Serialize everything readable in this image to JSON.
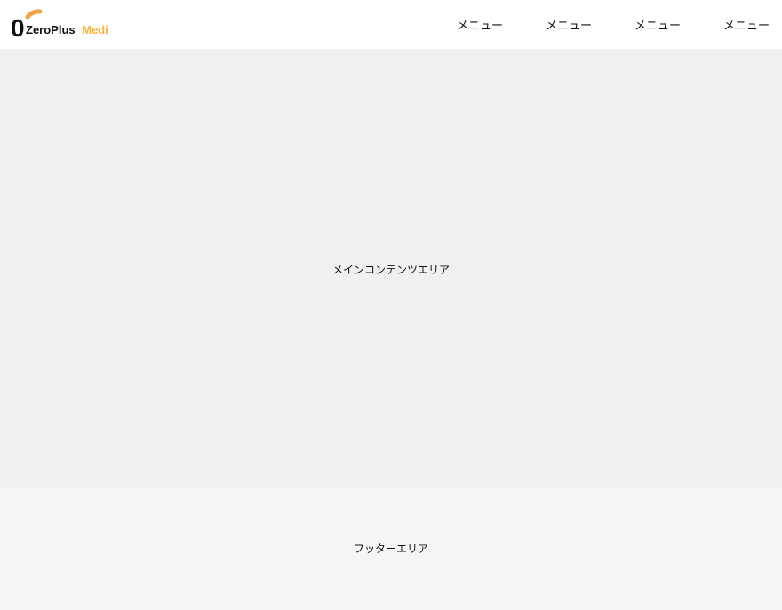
{
  "header": {
    "logo": {
      "glyph": "0",
      "brand_primary": "ZeroPlus",
      "brand_secondary": "Media",
      "primary_color": "#111111",
      "accent_color": "#f5b23d",
      "dot_color": "#f2a34a"
    },
    "nav": {
      "items": [
        {
          "label": "メニュー"
        },
        {
          "label": "メニュー"
        },
        {
          "label": "メニュー"
        },
        {
          "label": "メニュー"
        }
      ]
    }
  },
  "main": {
    "label": "メインコンテンツエリア",
    "background": "#f0f0f0"
  },
  "footer": {
    "label": "フッターエリア",
    "background": "#f5f5f5"
  }
}
